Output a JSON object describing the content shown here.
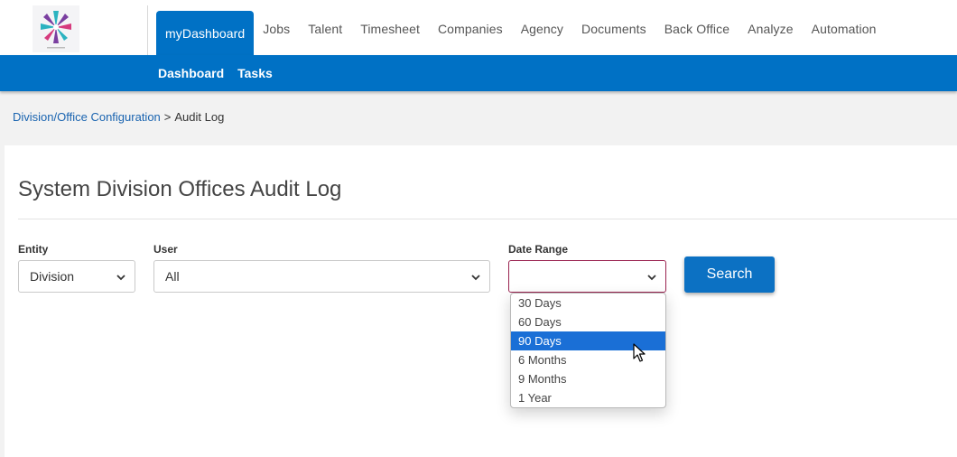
{
  "nav": {
    "items": [
      {
        "label": "myDashboard",
        "active": true
      },
      {
        "label": "Jobs"
      },
      {
        "label": "Talent"
      },
      {
        "label": "Timesheet"
      },
      {
        "label": "Companies"
      },
      {
        "label": "Agency"
      },
      {
        "label": "Documents"
      },
      {
        "label": "Back Office"
      },
      {
        "label": "Analyze"
      },
      {
        "label": "Automation"
      }
    ]
  },
  "subnav": {
    "items": [
      {
        "label": "Dashboard"
      },
      {
        "label": "Tasks"
      }
    ]
  },
  "breadcrumb": {
    "link": "Division/Office Configuration",
    "separator": ">",
    "current": "Audit Log"
  },
  "page": {
    "title": "System Division Offices Audit Log"
  },
  "filters": {
    "entity": {
      "label": "Entity",
      "value": "Division"
    },
    "user": {
      "label": "User",
      "value": "All"
    },
    "date_range": {
      "label": "Date Range",
      "value": "",
      "options": [
        "30 Days",
        "60 Days",
        "90 Days",
        "6 Months",
        "9 Months",
        "1 Year"
      ],
      "highlighted": "90 Days"
    },
    "search_label": "Search"
  },
  "colors": {
    "brand_blue": "#0071c5",
    "focus_border": "#9a2350",
    "option_highlight": "#1a6fd6"
  },
  "icons": {
    "logo": "star-burst-logo",
    "dropdown": "chevron-down-icon",
    "cursor": "mouse-pointer-icon"
  }
}
